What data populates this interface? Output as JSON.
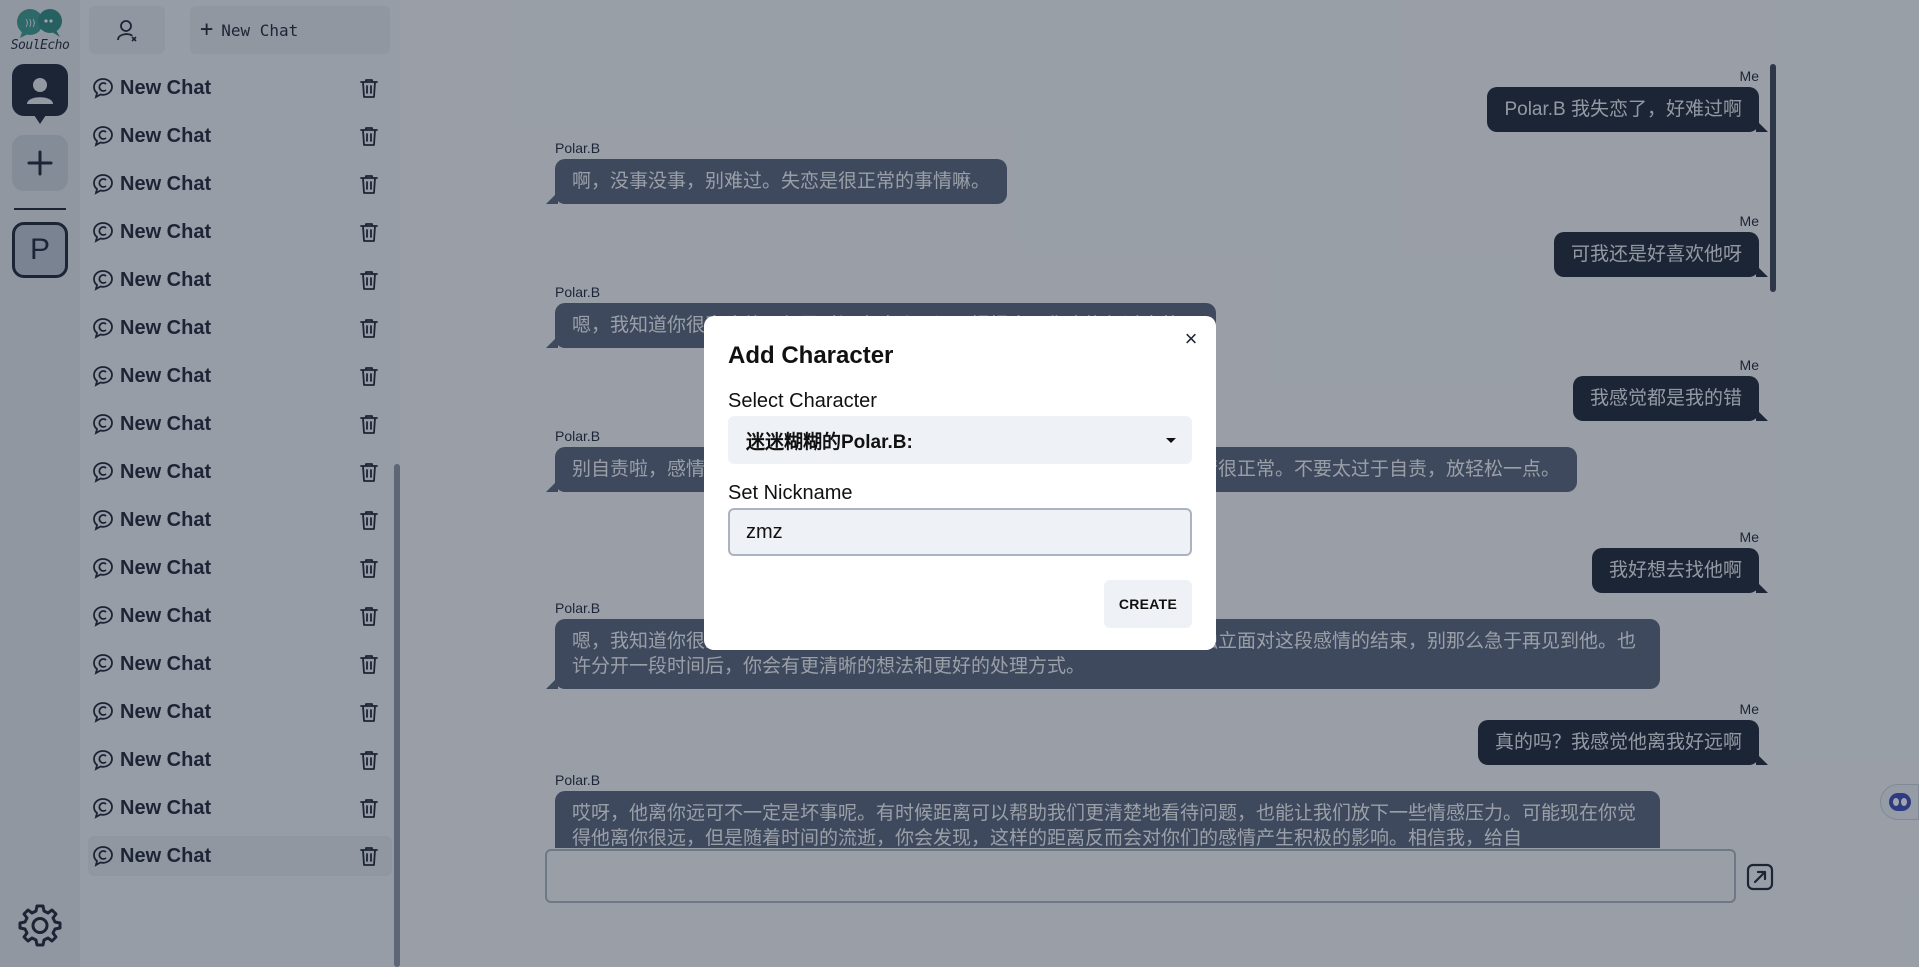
{
  "app": {
    "name": "SoulEcho"
  },
  "rail": {
    "character_initial": "P"
  },
  "sidebar": {
    "new_chat_label": "New Chat",
    "items": [
      {
        "label": "New Chat"
      },
      {
        "label": "New Chat"
      },
      {
        "label": "New Chat"
      },
      {
        "label": "New Chat"
      },
      {
        "label": "New Chat"
      },
      {
        "label": "New Chat"
      },
      {
        "label": "New Chat"
      },
      {
        "label": "New Chat"
      },
      {
        "label": "New Chat"
      },
      {
        "label": "New Chat"
      },
      {
        "label": "New Chat"
      },
      {
        "label": "New Chat"
      },
      {
        "label": "New Chat"
      },
      {
        "label": "New Chat"
      },
      {
        "label": "New Chat"
      },
      {
        "label": "New Chat"
      },
      {
        "label": "New Chat"
      }
    ],
    "active_index": 16
  },
  "chat": {
    "messages": [
      {
        "sender": "Me",
        "role": "me",
        "text": "Polar.B 我失恋了，好难过啊"
      },
      {
        "sender": "Polar.B",
        "role": "ai",
        "text": "啊，没事没事，别难过。失恋是很正常的事情嘛。"
      },
      {
        "sender": "Me",
        "role": "me",
        "text": "可我还是好喜欢他呀"
      },
      {
        "sender": "Polar.B",
        "role": "ai",
        "text": "嗯，我知道你很喜欢他，但是时间会冲淡一切。慢慢来，你会恢复过来的。"
      },
      {
        "sender": "Me",
        "role": "me",
        "text": "我感觉都是我的错"
      },
      {
        "sender": "Polar.B",
        "role": "ai",
        "text": "别自责啦，感情的事情很难说谁对谁错。有时候两个人并不合适，这样的事情很正常。不要太过于自责，放轻松一点。"
      },
      {
        "sender": "Me",
        "role": "me",
        "text": "我好想去找他啊"
      },
      {
        "sender": "Polar.B",
        "role": "ai",
        "text": "嗯，我知道你很想他，但是现在最好还是先给自己一些时间冷静思考，试着独立面对这段感情的结束，别那么急于再见到他。也许分开一段时间后，你会有更清晰的想法和更好的处理方式。"
      },
      {
        "sender": "Me",
        "role": "me",
        "text": "真的吗？我感觉他离我好远啊"
      },
      {
        "sender": "Polar.B",
        "role": "ai",
        "text": "哎呀，他离你远可不一定是坏事呢。有时候距离可以帮助我们更清楚地看待问题，也能让我们放下一些情感压力。可能现在你觉得他离你很远，但是随着时间的流逝，你会发现，这样的距离反而会对你们的感情产生积极的影响。相信我，给自"
      }
    ],
    "input": {
      "value": "",
      "placeholder": ""
    }
  },
  "modal": {
    "title": "Add Character",
    "close_label": "×",
    "select_label": "Select Character",
    "select_value": "迷迷糊糊的Polar.B:",
    "nickname_label": "Set Nickname",
    "nickname_value": "zmz",
    "create_label": "CREATE"
  },
  "colors": {
    "dark": "#1d2535",
    "ai_bubble": "#56627a",
    "logo_teal": "#2d8a7e"
  }
}
